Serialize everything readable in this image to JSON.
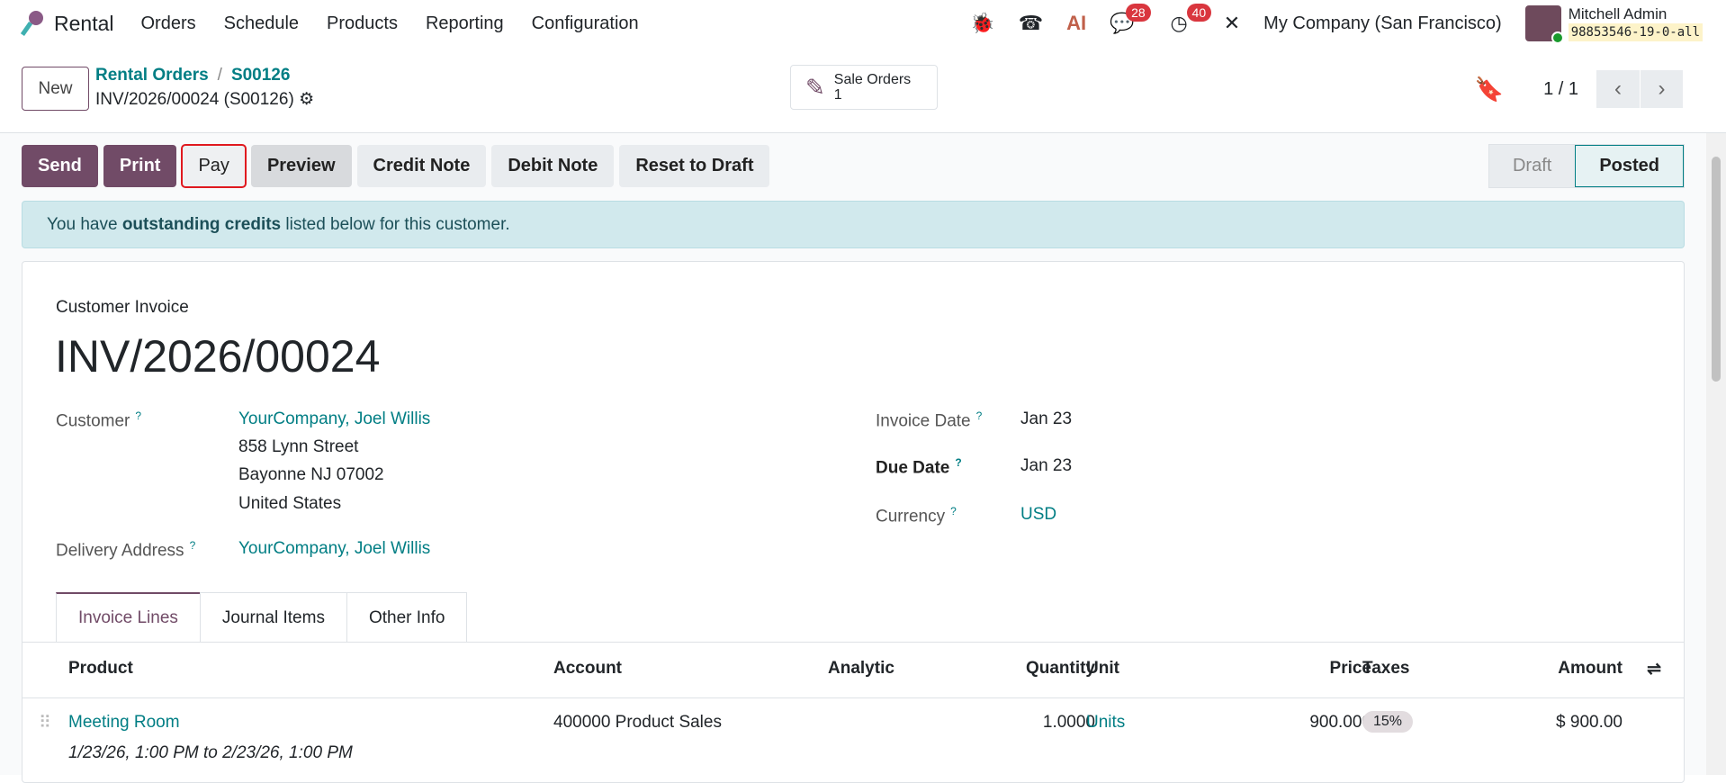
{
  "nav": {
    "app": "Rental",
    "menus": [
      "Orders",
      "Schedule",
      "Products",
      "Reporting",
      "Configuration"
    ],
    "messages_count": "28",
    "activities_count": "40",
    "company": "My Company (San Francisco)",
    "user": "Mitchell Admin",
    "database": "98853546-19-0-all",
    "icons": [
      "bug-icon",
      "phone-icon",
      "ai-icon",
      "chat-icon",
      "clock-icon",
      "tools-icon"
    ]
  },
  "control": {
    "new_label": "New",
    "breadcrumb": [
      "Rental Orders",
      "S00126"
    ],
    "current": "INV/2026/00024 (S00126)",
    "smart_button": {
      "label": "Sale Orders",
      "count": "1"
    },
    "pager": "1 / 1"
  },
  "actions": [
    "Send",
    "Print",
    "Pay",
    "Preview",
    "Credit Note",
    "Debit Note",
    "Reset to Draft"
  ],
  "statusbar": [
    "Draft",
    "Posted"
  ],
  "alert": {
    "pre": "You have ",
    "bold": "outstanding credits",
    "post": " listed below for this customer."
  },
  "invoice": {
    "type": "Customer Invoice",
    "number": "INV/2026/00024",
    "customer_label": "Customer",
    "customer": "YourCompany, Joel Willis",
    "address": [
      "858 Lynn Street",
      "Bayonne NJ 07002",
      "United States"
    ],
    "delivery_label": "Delivery Address",
    "delivery": "YourCompany, Joel Willis",
    "invoice_date_label": "Invoice Date",
    "invoice_date": "Jan 23",
    "due_date_label": "Due Date",
    "due_date": "Jan 23",
    "currency_label": "Currency",
    "currency": "USD",
    "help": "?"
  },
  "tabs": [
    "Invoice Lines",
    "Journal Items",
    "Other Info"
  ],
  "table": {
    "headers": [
      "Product",
      "Account",
      "Analytic",
      "Quantity",
      "Unit",
      "Price",
      "Taxes",
      "Amount"
    ],
    "rows": [
      {
        "product": "Meeting Room",
        "description": "1/23/26, 1:00 PM to 2/23/26, 1:00 PM",
        "account": "400000 Product Sales",
        "analytic": "",
        "quantity": "1.0000",
        "unit": "Units",
        "price": "900.000",
        "taxes": "15%",
        "amount": "$ 900.00"
      }
    ]
  }
}
